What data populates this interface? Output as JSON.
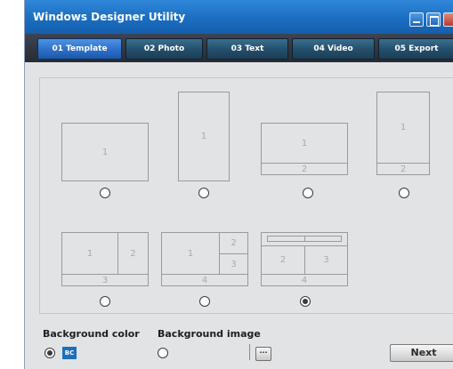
{
  "window": {
    "title": "Windows Designer Utility"
  },
  "tabs": [
    {
      "label": "01 Template",
      "active": true
    },
    {
      "label": "02 Photo",
      "active": false
    },
    {
      "label": "03 Text",
      "active": false
    },
    {
      "label": "04 Video",
      "active": false
    },
    {
      "label": "05 Export",
      "active": false
    }
  ],
  "templates": [
    {
      "regions": [
        "1"
      ],
      "selected": false
    },
    {
      "regions": [
        "1"
      ],
      "selected": false
    },
    {
      "regions": [
        "1",
        "2"
      ],
      "selected": false
    },
    {
      "regions": [
        "1",
        "2"
      ],
      "selected": false
    },
    {
      "regions": [
        "1",
        "2",
        "3"
      ],
      "selected": false
    },
    {
      "regions": [
        "1",
        "2",
        "3",
        "4"
      ],
      "selected": false
    },
    {
      "regions": [
        "2",
        "3",
        "4"
      ],
      "selected": true
    }
  ],
  "background": {
    "color_label": "Background color",
    "color_swatch_text": "BC",
    "color_value": "#1d6fbf",
    "color_selected": true,
    "image_label": "Background image",
    "image_selected": false,
    "browse_label": "···"
  },
  "footer": {
    "next_label": "Next"
  }
}
